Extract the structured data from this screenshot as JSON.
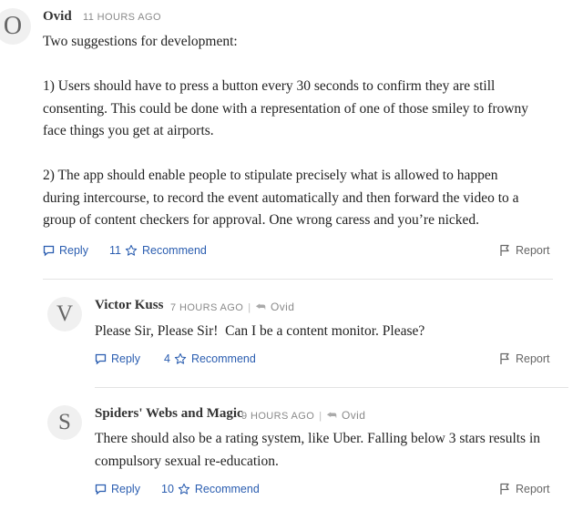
{
  "comments": [
    {
      "avatar": "O",
      "author": "Ovid",
      "time": "11 HOURS AGO",
      "paragraphs": [
        "Two suggestions for development:",
        "1) Users should have to press a button every 30 seconds to confirm they are still",
        "consenting. This could be done with a representation of one of those smiley to frowny",
        "face things you get at airports.",
        "2) The app should enable people to stipulate precisely what is allowed to happen",
        "during intercourse, to record the event automatically and then forward the video to a",
        "group of content checkers for approval. One wrong caress and you’re nicked."
      ],
      "reply_label": "Reply",
      "recommend_count": "11",
      "recommend_label": "Recommend",
      "report_label": "Report"
    },
    {
      "avatar": "V",
      "author": "Victor Kuss",
      "time": "7 HOURS AGO",
      "in_reply_to": "Ovid",
      "paragraphs": [
        "Please Sir, Please Sir!  Can I be a content monitor. Please?"
      ],
      "reply_label": "Reply",
      "recommend_count": "4",
      "recommend_label": "Recommend",
      "report_label": "Report"
    },
    {
      "avatar": "S",
      "author": "Spiders' Webs and Magic",
      "time": "9 HOURS AGO",
      "in_reply_to": "Ovid",
      "paragraphs": [
        "There should also be a rating system, like Uber. Falling below 3 stars results in",
        "compulsory sexual re-education."
      ],
      "reply_label": "Reply",
      "recommend_count": "10",
      "recommend_label": "Recommend",
      "report_label": "Report"
    }
  ],
  "colors": {
    "link": "#2a5db0",
    "muted": "#8a8a8a",
    "divider": "#e3e3e3"
  },
  "icons": {
    "reply": "speech-bubble-icon",
    "recommend": "star-outline-icon",
    "report": "flag-icon",
    "parent": "reply-arrow-icon"
  }
}
